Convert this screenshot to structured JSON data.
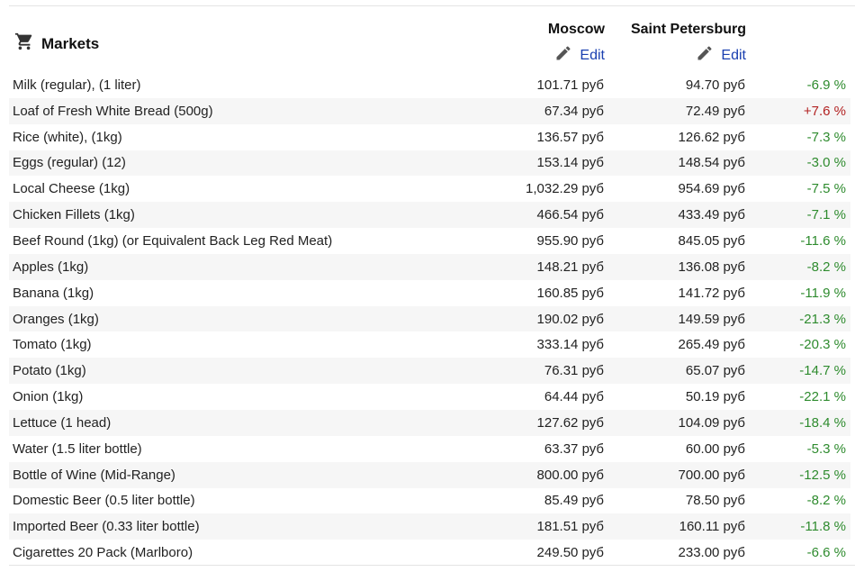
{
  "section": {
    "title": "Markets",
    "icon": "shopping-cart-icon"
  },
  "cities": [
    {
      "name": "Moscow",
      "edit_label": "Edit"
    },
    {
      "name": "Saint Petersburg",
      "edit_label": "Edit"
    }
  ],
  "colors": {
    "positive": "#2e8b2e",
    "negative": "#b22222",
    "link": "#1a3fb0"
  },
  "rows": [
    {
      "item": "Milk (regular), (1 liter)",
      "moscow": "101.71 руб",
      "spb": "94.70 руб",
      "diff": "-6.9 %",
      "dir": "neg"
    },
    {
      "item": "Loaf of Fresh White Bread (500g)",
      "moscow": "67.34 руб",
      "spb": "72.49 руб",
      "diff": "+7.6 %",
      "dir": "pos"
    },
    {
      "item": "Rice (white), (1kg)",
      "moscow": "136.57 руб",
      "spb": "126.62 руб",
      "diff": "-7.3 %",
      "dir": "neg"
    },
    {
      "item": "Eggs (regular) (12)",
      "moscow": "153.14 руб",
      "spb": "148.54 руб",
      "diff": "-3.0 %",
      "dir": "neg"
    },
    {
      "item": "Local Cheese (1kg)",
      "moscow": "1,032.29 руб",
      "spb": "954.69 руб",
      "diff": "-7.5 %",
      "dir": "neg"
    },
    {
      "item": "Chicken Fillets (1kg)",
      "moscow": "466.54 руб",
      "spb": "433.49 руб",
      "diff": "-7.1 %",
      "dir": "neg"
    },
    {
      "item": "Beef Round (1kg) (or Equivalent Back Leg Red Meat)",
      "moscow": "955.90 руб",
      "spb": "845.05 руб",
      "diff": "-11.6 %",
      "dir": "neg"
    },
    {
      "item": "Apples (1kg)",
      "moscow": "148.21 руб",
      "spb": "136.08 руб",
      "diff": "-8.2 %",
      "dir": "neg"
    },
    {
      "item": "Banana (1kg)",
      "moscow": "160.85 руб",
      "spb": "141.72 руб",
      "diff": "-11.9 %",
      "dir": "neg"
    },
    {
      "item": "Oranges (1kg)",
      "moscow": "190.02 руб",
      "spb": "149.59 руб",
      "diff": "-21.3 %",
      "dir": "neg"
    },
    {
      "item": "Tomato (1kg)",
      "moscow": "333.14 руб",
      "spb": "265.49 руб",
      "diff": "-20.3 %",
      "dir": "neg"
    },
    {
      "item": "Potato (1kg)",
      "moscow": "76.31 руб",
      "spb": "65.07 руб",
      "diff": "-14.7 %",
      "dir": "neg"
    },
    {
      "item": "Onion (1kg)",
      "moscow": "64.44 руб",
      "spb": "50.19 руб",
      "diff": "-22.1 %",
      "dir": "neg"
    },
    {
      "item": "Lettuce (1 head)",
      "moscow": "127.62 руб",
      "spb": "104.09 руб",
      "diff": "-18.4 %",
      "dir": "neg"
    },
    {
      "item": "Water (1.5 liter bottle)",
      "moscow": "63.37 руб",
      "spb": "60.00 руб",
      "diff": "-5.3 %",
      "dir": "neg"
    },
    {
      "item": "Bottle of Wine (Mid-Range)",
      "moscow": "800.00 руб",
      "spb": "700.00 руб",
      "diff": "-12.5 %",
      "dir": "neg"
    },
    {
      "item": "Domestic Beer (0.5 liter bottle)",
      "moscow": "85.49 руб",
      "spb": "78.50 руб",
      "diff": "-8.2 %",
      "dir": "neg"
    },
    {
      "item": "Imported Beer (0.33 liter bottle)",
      "moscow": "181.51 руб",
      "spb": "160.11 руб",
      "diff": "-11.8 %",
      "dir": "neg"
    },
    {
      "item": "Cigarettes 20 Pack (Marlboro)",
      "moscow": "249.50 руб",
      "spb": "233.00 руб",
      "diff": "-6.6 %",
      "dir": "neg"
    }
  ]
}
